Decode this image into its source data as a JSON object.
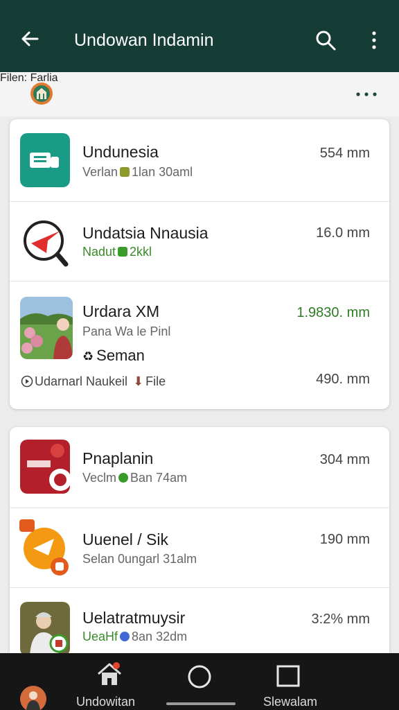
{
  "appbar": {
    "title": "Undowan Indamin",
    "back_icon": "arrow-left-icon",
    "search_icon": "search-icon",
    "more_icon": "more-vertical-icon",
    "bg_color": "#163d35"
  },
  "subheader": {
    "label": "Filen: Farlia",
    "more_icon": "more-horizontal-icon"
  },
  "items": [
    {
      "title": "Undunesia",
      "subtitle_a": "Verlan",
      "subtitle_b": "1lan 30aml",
      "size": "55",
      "size_suffix": "4 mm"
    },
    {
      "title": "Undatsia Nnausia",
      "subtitle_a": "Nadut",
      "subtitle_b": "2kkl",
      "size": "16.0",
      "size_suffix": " mm"
    },
    {
      "title": "Urdara XM",
      "subtitle_a": "Pana Wa le Pinl",
      "subtitle_b": "Seman",
      "size": "1.9830.",
      "size_suffix": " mm",
      "extra_label": "Udarnarl Naukeil",
      "extra_file": "File",
      "extra_size": "490.",
      "extra_size_suffix": " mm"
    },
    {
      "title": "Pnaplanin",
      "subtitle_a": "Veclm",
      "subtitle_b": "Ban 74am",
      "size": "304",
      "size_suffix": " mm"
    },
    {
      "title": "Uuenel / Sik",
      "subtitle_a": "Selan 0ungarl 31alm",
      "size": "190",
      "size_suffix": " mm"
    },
    {
      "title": "Uelatratmuysir",
      "subtitle_a": "UeaHf",
      "subtitle_b": "8an 32dm",
      "size": "3:2%",
      "size_suffix": " mm"
    }
  ],
  "bottomnav": {
    "home_label": "Undowitan",
    "settings_label": "Slewalam",
    "home_icon": "home-icon",
    "circle_icon": "circle-icon",
    "square_icon": "square-icon"
  }
}
